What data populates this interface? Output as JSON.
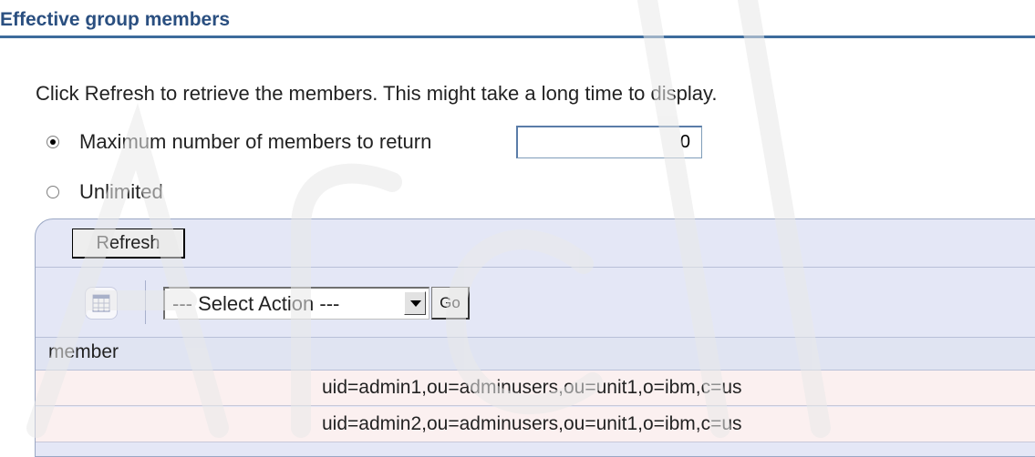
{
  "section": {
    "title": "Effective group members"
  },
  "intro_text": "Click Refresh to retrieve the members. This might take a long time to display.",
  "options": {
    "max_label": "Maximum number of members to return",
    "max_value": "0",
    "unlimited_label": "Unlimited",
    "selected": "max"
  },
  "buttons": {
    "refresh": "Refresh",
    "go": "Go"
  },
  "action_select": {
    "selected": "--- Select Action ---"
  },
  "table": {
    "column_header": "member",
    "rows": [
      "uid=admin1,ou=adminusers,ou=unit1,o=ibm,c=us",
      "uid=admin2,ou=adminusers,ou=unit1,o=ibm,c=us"
    ]
  },
  "colors": {
    "title": "#2a4f80",
    "title_rule": "#3d6b9c",
    "panel": "#e4e7f6",
    "row": "#fbf0f0"
  },
  "icons": {
    "preferences": "table-preferences-icon"
  }
}
